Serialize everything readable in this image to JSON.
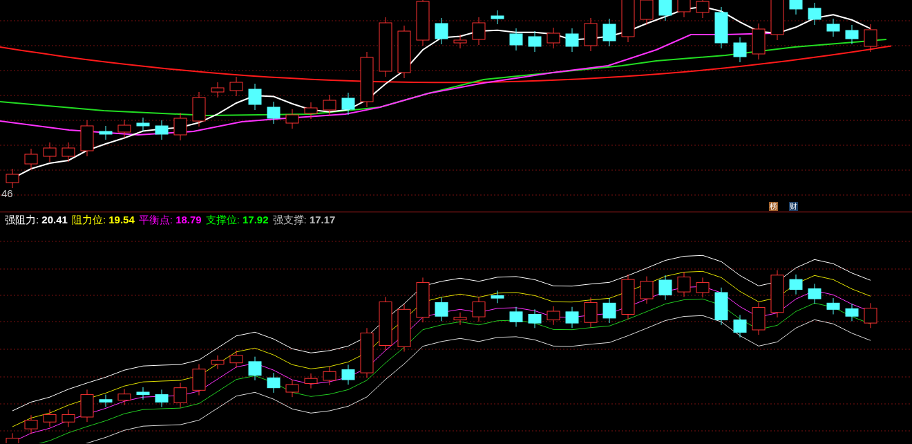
{
  "price_panel": {
    "axis_label": "46",
    "badges": [
      {
        "label": "榜",
        "color": "#a0602a"
      },
      {
        "label": "财",
        "color": "#1c3f66"
      }
    ]
  },
  "indicator_panel": {
    "legend": [
      {
        "name": "强阻力:",
        "value": "20.41",
        "color": "#ffffff"
      },
      {
        "name": "阻力位:",
        "value": "19.54",
        "color": "#ffff00"
      },
      {
        "name": "平衡点:",
        "value": "18.79",
        "color": "#ff00ff"
      },
      {
        "name": "支撑位:",
        "value": "17.92",
        "color": "#00ff00"
      },
      {
        "name": "强支撑:",
        "value": "17.17",
        "color": "#c0c0c0"
      }
    ]
  }
}
